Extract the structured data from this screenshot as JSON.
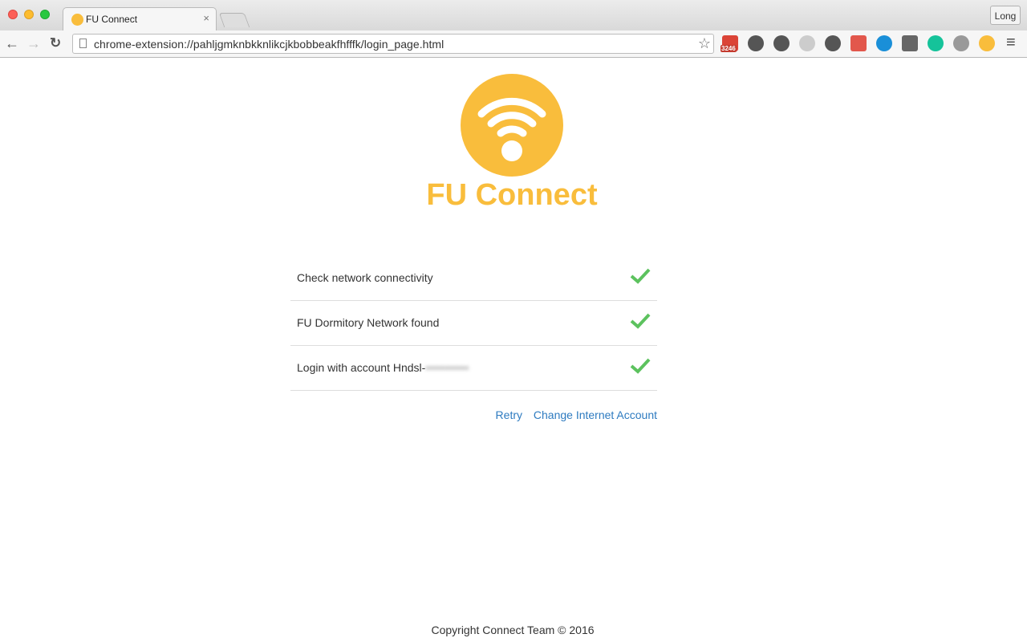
{
  "browser": {
    "tab_title": "FU Connect",
    "tab_close": "×",
    "profile_label": "Long",
    "url": "chrome-extension://pahljgmknbkknlikcjkbobbeakfhfffk/login_page.html",
    "nav": {
      "back": "←",
      "forward": "→",
      "reload": "↻",
      "star": "☆",
      "menu": "≡"
    },
    "extensions": [
      {
        "name": "gmail-checker",
        "badge": "3246",
        "color": "#db4437"
      },
      {
        "name": "pocket",
        "color": "#555555"
      },
      {
        "name": "adblock-hand",
        "color": "#555555"
      },
      {
        "name": "react-devtools",
        "color": "#cccccc"
      },
      {
        "name": "tampermonkey",
        "color": "#555555"
      },
      {
        "name": "acrobat",
        "color": "#e2574c"
      },
      {
        "name": "diamond",
        "color": "#1a8fd8"
      },
      {
        "name": "outlet-plug",
        "color": "#666666"
      },
      {
        "name": "grammarly",
        "color": "#15c39a"
      },
      {
        "name": "facebook-ext",
        "color": "#999999"
      },
      {
        "name": "fu-connect",
        "color": "#f9bd3c"
      }
    ]
  },
  "app": {
    "title": "FU Connect",
    "brand_color": "#f9bd3c",
    "checks": [
      {
        "label": "Check network connectivity",
        "status": "ok",
        "redacted": ""
      },
      {
        "label": "FU Dormitory Network found",
        "status": "ok",
        "redacted": ""
      },
      {
        "label": "Login with account Hndsl-",
        "status": "ok",
        "redacted": "•••••••••••"
      }
    ],
    "check_color": "#5cc25e",
    "actions": {
      "retry": "Retry",
      "change_account": "Change Internet Account"
    },
    "footer": "Copyright Connect Team © 2016"
  }
}
